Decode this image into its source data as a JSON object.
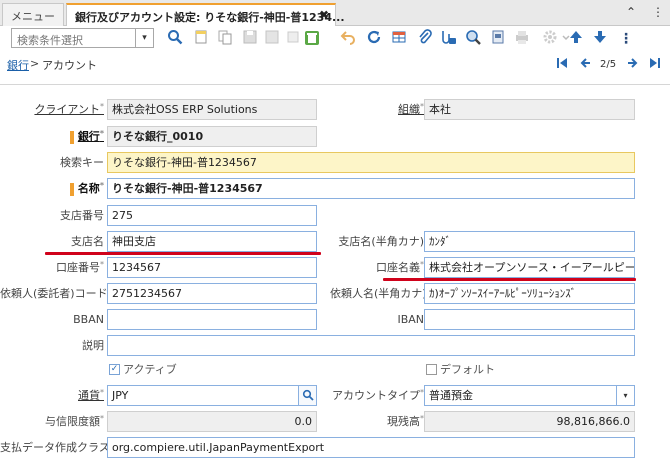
{
  "tabs": {
    "home_label": "メニュー",
    "active_label": "銀行及びアカウント設定: りそな銀行-神田-普1234...",
    "close_glyph": "✖",
    "collapse_glyph": "⌃",
    "menu_glyph": "⋮"
  },
  "toolbar": {
    "search_placeholder": "検索条件選択",
    "dropdown_glyph": "▾"
  },
  "breadcrumb": {
    "parent": "銀行",
    "separator": ">",
    "current": "アカウント",
    "page": "2/5"
  },
  "form": {
    "client": {
      "label": "クライアント",
      "value": "株式会社OSS ERP Solutions"
    },
    "org": {
      "label": "組織",
      "value": "本社"
    },
    "bank": {
      "label": "銀行",
      "value": "りそな銀行_0010"
    },
    "search_key": {
      "label": "検索キー",
      "value": "りそな銀行-神田-普1234567"
    },
    "name": {
      "label": "名称",
      "value": "りそな銀行-神田-普1234567"
    },
    "branch_no": {
      "label": "支店番号",
      "value": "275"
    },
    "branch_name": {
      "label": "支店名",
      "value": "神田支店"
    },
    "branch_name_kana": {
      "label": "支店名(半角カナ)",
      "value": "ｶﾝﾀﾞ"
    },
    "account_no": {
      "label": "口座番号",
      "value": "1234567"
    },
    "account_holder": {
      "label": "口座名義",
      "value": "株式会社オープンソース・イーアールピー・"
    },
    "requester_code": {
      "label": "依頼人(委託者)コード",
      "value": "2751234567"
    },
    "requester_name": {
      "label": "依頼人名(半角カナ)",
      "value": "ｶ)ｵｰﾌﾟﾝｿｰｽｲｰｱｰﾙﾋﾟｰｿﾘｭｰｼｮﾝｽﾞ"
    },
    "bban": {
      "label": "BBAN",
      "value": ""
    },
    "iban": {
      "label": "IBAN",
      "value": ""
    },
    "description": {
      "label": "説明",
      "value": ""
    },
    "active": {
      "label": "アクティブ",
      "checked": true
    },
    "default": {
      "label": "デフォルト",
      "checked": false
    },
    "currency": {
      "label": "通貨",
      "value": "JPY"
    },
    "account_type": {
      "label": "アカウントタイプ",
      "value": "普通預金"
    },
    "credit_limit": {
      "label": "与信限度額",
      "value": "0.0"
    },
    "current_balance": {
      "label": "現残高",
      "value": "98,816,866.0"
    },
    "payment_export_class": {
      "label": "支払データ作成クラス",
      "value": "org.compiere.util.JapanPaymentExport"
    }
  },
  "colors": {
    "accent_orange": "#f0a030",
    "field_border_blue": "#8ab0e0",
    "link_blue": "#1a5fa8",
    "annotation_red": "#d0021b"
  }
}
